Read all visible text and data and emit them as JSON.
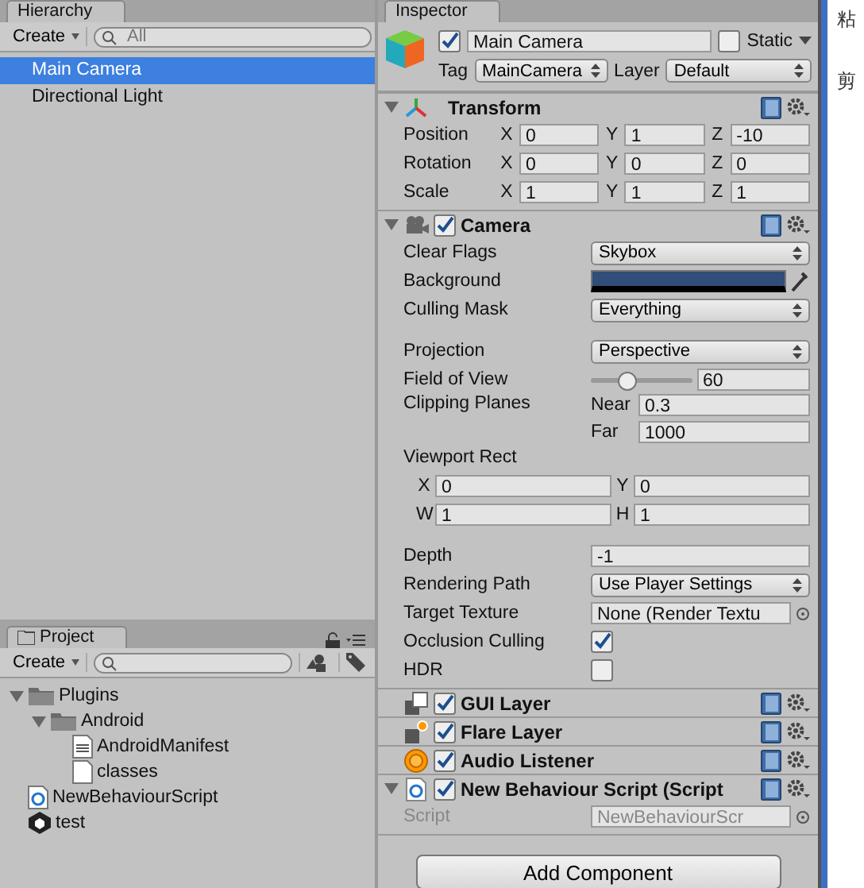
{
  "hierarchy": {
    "title": "Hierarchy",
    "create": "Create",
    "search_placeholder": "All",
    "items": [
      {
        "label": "Main Camera",
        "selected": true
      },
      {
        "label": "Directional Light",
        "selected": false
      }
    ]
  },
  "project": {
    "title": "Project",
    "create": "Create",
    "items": [
      {
        "label": "Plugins",
        "kind": "folder",
        "expanded": true,
        "children": [
          {
            "label": "Android",
            "kind": "folder",
            "expanded": true,
            "children": [
              {
                "label": "AndroidManifest",
                "kind": "text"
              },
              {
                "label": "classes",
                "kind": "file"
              }
            ]
          }
        ]
      },
      {
        "label": "NewBehaviourScript",
        "kind": "script"
      },
      {
        "label": "test",
        "kind": "scene"
      }
    ]
  },
  "inspector": {
    "title": "Inspector",
    "object": {
      "active": true,
      "name": "Main Camera",
      "static": false,
      "static_label": "Static",
      "tag_label": "Tag",
      "tag": "MainCamera",
      "layer_label": "Layer",
      "layer": "Default"
    },
    "components": [
      {
        "kind": "transform",
        "name": "Transform",
        "expanded": true,
        "rows": [
          {
            "kind": "vec",
            "label": "Position",
            "fields": [
              {
                "axis": "X",
                "value": "0"
              },
              {
                "axis": "Y",
                "value": "1"
              },
              {
                "axis": "Z",
                "value": "-10"
              }
            ]
          },
          {
            "kind": "vec",
            "label": "Rotation",
            "fields": [
              {
                "axis": "X",
                "value": "0"
              },
              {
                "axis": "Y",
                "value": "0"
              },
              {
                "axis": "Z",
                "value": "0"
              }
            ]
          },
          {
            "kind": "vec",
            "label": "Scale",
            "fields": [
              {
                "axis": "X",
                "value": "1"
              },
              {
                "axis": "Y",
                "value": "1"
              },
              {
                "axis": "Z",
                "value": "1"
              }
            ]
          }
        ]
      },
      {
        "kind": "camera",
        "name": "Camera",
        "enabled": true,
        "expanded": true,
        "rows": [
          {
            "kind": "select",
            "label": "Clear Flags",
            "value": "Skybox"
          },
          {
            "kind": "color",
            "label": "Background",
            "color": "#314d79"
          },
          {
            "kind": "select",
            "label": "Culling Mask",
            "value": "Everything"
          },
          {
            "kind": "select",
            "label": "Projection",
            "value": "Perspective",
            "gap_before": true
          },
          {
            "kind": "slider",
            "label": "Field of View",
            "level": 0.35,
            "value": "60"
          },
          {
            "kind": "clip",
            "label": "Clipping Planes",
            "fields": [
              {
                "axis": "Near",
                "value": "0.3"
              },
              {
                "axis": "Far",
                "value": "1000"
              }
            ]
          },
          {
            "kind": "heading",
            "label": "Viewport Rect"
          },
          {
            "kind": "xy",
            "fields": [
              {
                "axis": "X",
                "value": "0"
              },
              {
                "axis": "Y",
                "value": "0"
              }
            ]
          },
          {
            "kind": "xy",
            "fields": [
              {
                "axis": "W",
                "value": "1"
              },
              {
                "axis": "H",
                "value": "1"
              }
            ]
          },
          {
            "kind": "number",
            "label": "Depth",
            "value": "-1",
            "gap_before": true
          },
          {
            "kind": "select",
            "label": "Rendering Path",
            "value": "Use Player Settings"
          },
          {
            "kind": "object",
            "label": "Target Texture",
            "value": "None (Render Textu"
          },
          {
            "kind": "check",
            "label": "Occlusion Culling",
            "checked": true
          },
          {
            "kind": "check",
            "label": "HDR",
            "checked": false
          }
        ]
      },
      {
        "kind": "guilayer",
        "name": "GUI Layer",
        "enabled": true
      },
      {
        "kind": "flare",
        "name": "Flare Layer",
        "enabled": true
      },
      {
        "kind": "audio",
        "name": "Audio Listener",
        "enabled": true
      },
      {
        "kind": "script",
        "name": "New Behaviour Script (Script",
        "enabled": true,
        "expanded": true,
        "rows": [
          {
            "kind": "object",
            "label": "Script",
            "value": "NewBehaviourScr",
            "disabled": true
          }
        ]
      }
    ],
    "add_button": "Add Component"
  },
  "side": {
    "chars": [
      "粘",
      "剪"
    ]
  }
}
